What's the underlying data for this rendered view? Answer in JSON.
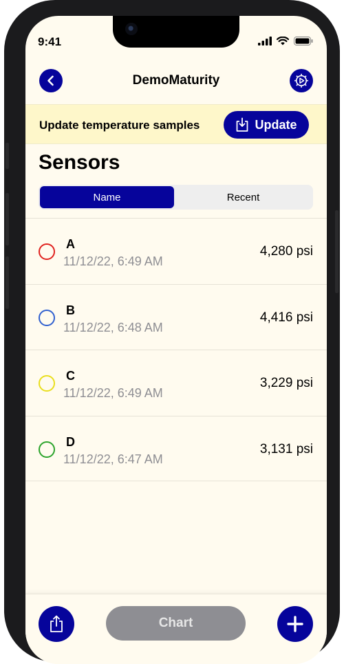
{
  "status_bar": {
    "time": "9:41"
  },
  "nav": {
    "title": "DemoMaturity"
  },
  "banner": {
    "text": "Update temperature samples",
    "button_label": "Update"
  },
  "section_title": "Sensors",
  "segments": [
    {
      "label": "Name",
      "selected": true
    },
    {
      "label": "Recent",
      "selected": false
    }
  ],
  "sensors": [
    {
      "name": "A",
      "date": "11/12/22, 6:49 AM",
      "value": "4,280 psi",
      "color": "#e0211e"
    },
    {
      "name": "B",
      "date": "11/12/22, 6:48 AM",
      "value": "4,416 psi",
      "color": "#2f5fcf"
    },
    {
      "name": "C",
      "date": "11/12/22, 6:49 AM",
      "value": "3,229 psi",
      "color": "#e9de1c"
    },
    {
      "name": "D",
      "date": "11/12/22, 6:47 AM",
      "value": "3,131 psi",
      "color": "#2aa32a"
    }
  ],
  "bottom_bar": {
    "chart_label": "Chart"
  },
  "colors": {
    "accent": "#06049b",
    "background": "#fffbef",
    "banner": "#fef7ca",
    "disabled": "#8e8e93"
  },
  "icons": {
    "back": "chevron-left-icon",
    "settings": "gear-play-icon",
    "update": "download-tray-icon",
    "share": "share-icon",
    "add": "plus-icon"
  }
}
